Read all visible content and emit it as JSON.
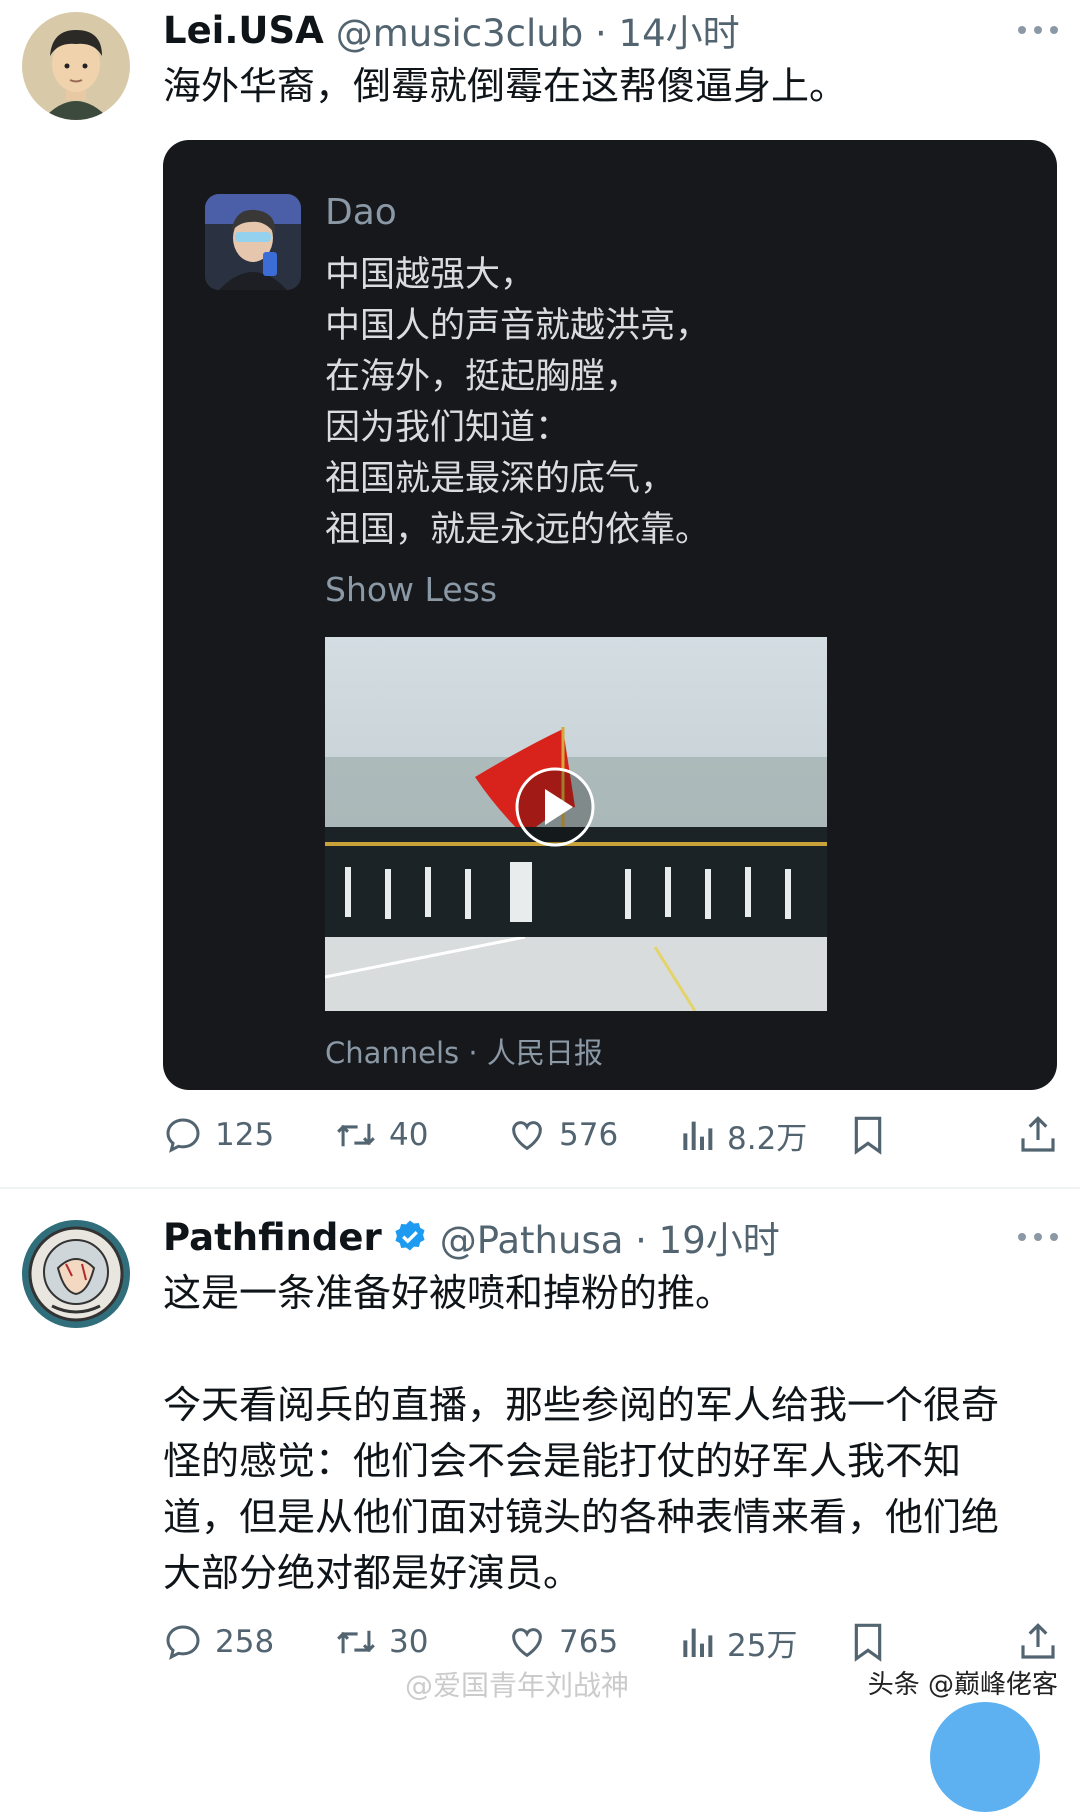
{
  "tweet1": {
    "name": "Lei.USA",
    "handle": "@music3club · 14小时",
    "text": "海外华裔，倒霉就倒霉在这帮傻逼身上。",
    "quote": {
      "name": "Dao",
      "lines": [
        "中国越强大，",
        "中国人的声音就越洪亮，",
        "在海外，挺起胸膛，",
        "因为我们知道：",
        "祖国就是最深的底气，",
        "祖国，就是永远的依靠。"
      ],
      "show_less": "Show Less",
      "channel": "Channels · 人民日报"
    },
    "stats": {
      "replies": "125",
      "retweets": "40",
      "likes": "576",
      "views": "8.2万"
    }
  },
  "tweet2": {
    "name": "Pathfinder",
    "handle": "@Pathusa · 19小时",
    "line1": "这是一条准备好被喷和掉粉的推。",
    "lines": [
      "今天看阅兵的直播，那些参阅的军人给我一个很奇",
      "怪的感觉：他们会不会是能打仗的好军人我不知",
      "道，但是从他们面对镜头的各种表情来看，他们绝",
      "大部分绝对都是好演员。"
    ],
    "stats": {
      "replies": "258",
      "retweets": "30",
      "likes": "765",
      "views": "25万"
    }
  },
  "watermark": "@爱国青年刘战神",
  "credit": "头条 @巅峰佬客",
  "colors": {
    "verified": "#1d9bf0",
    "muted": "#536471",
    "card": "#16181c"
  },
  "icons": [
    "reply-icon",
    "retweet-icon",
    "like-icon",
    "views-icon",
    "bookmark-icon",
    "share-icon",
    "verified-badge-icon",
    "play-icon",
    "more-icon"
  ]
}
